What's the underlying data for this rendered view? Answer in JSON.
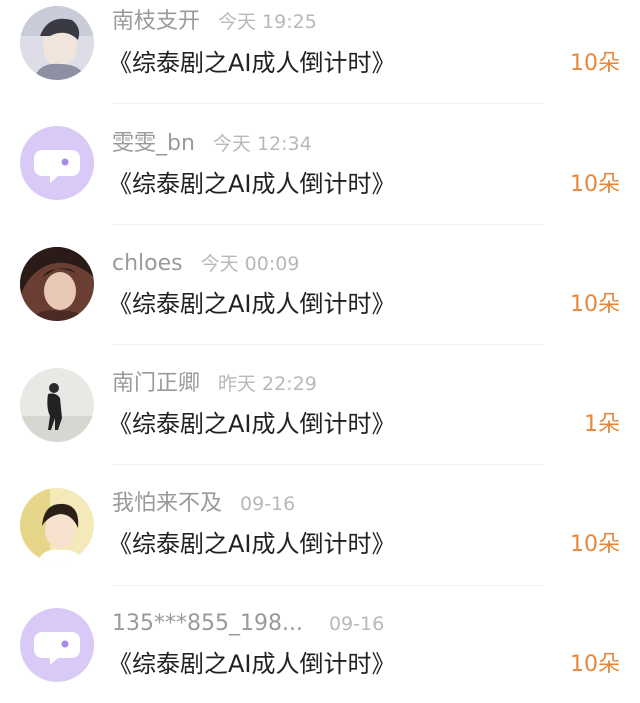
{
  "colors": {
    "accent": "#e8873a",
    "name": "#9a9a9a",
    "time": "#b8b8b8",
    "title": "#222222",
    "default_avatar_bg": "#d9c9f7"
  },
  "items": [
    {
      "name": "南枝支开",
      "time": "今天 19:25",
      "title": "《综泰剧之AI成人倒计时》",
      "count": "10朵",
      "avatar": "photo-portrait-avatar"
    },
    {
      "name": "雯雯_bn",
      "time": "今天 12:34",
      "title": "《综泰剧之AI成人倒计时》",
      "count": "10朵",
      "avatar": "default-chat-avatar"
    },
    {
      "name": "chloes",
      "time": "今天 00:09",
      "title": "《综泰剧之AI成人倒计时》",
      "count": "10朵",
      "avatar": "photo-portrait-avatar"
    },
    {
      "name": "南门正卿",
      "time": "昨天 22:29",
      "title": "《综泰剧之AI成人倒计时》",
      "count": "1朵",
      "avatar": "photo-silhouette-avatar"
    },
    {
      "name": "我怕来不及",
      "time": "09-16",
      "title": "《综泰剧之AI成人倒计时》",
      "count": "10朵",
      "avatar": "photo-portrait-avatar"
    },
    {
      "name": "135***855_198...",
      "time": "09-16",
      "title": "《综泰剧之AI成人倒计时》",
      "count": "10朵",
      "avatar": "default-chat-avatar"
    }
  ]
}
